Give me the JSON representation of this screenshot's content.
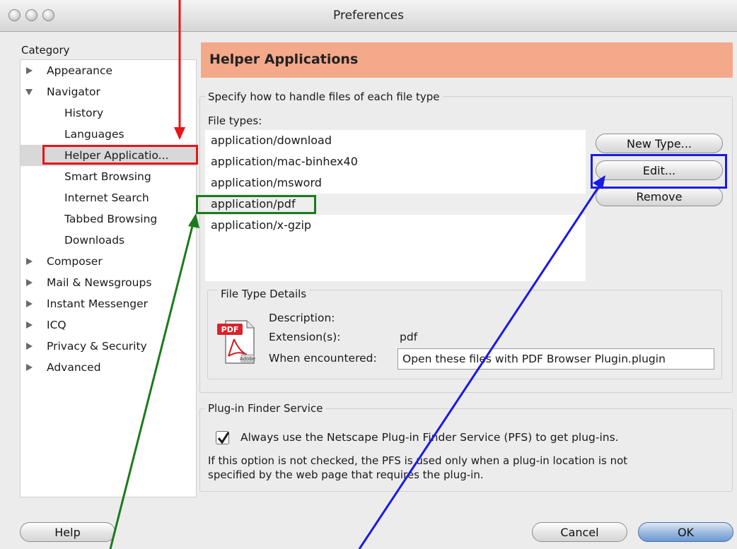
{
  "window": {
    "title": "Preferences"
  },
  "sidebar": {
    "category_label": "Category",
    "items": [
      {
        "label": "Appearance",
        "expander": "collapsed"
      },
      {
        "label": "Navigator",
        "expander": "expanded"
      },
      {
        "label": "History"
      },
      {
        "label": "Languages"
      },
      {
        "label": "Helper Applicatio..."
      },
      {
        "label": "Smart Browsing"
      },
      {
        "label": "Internet Search"
      },
      {
        "label": "Tabbed Browsing"
      },
      {
        "label": "Downloads"
      },
      {
        "label": "Composer",
        "expander": "collapsed"
      },
      {
        "label": "Mail & Newsgroups",
        "expander": "collapsed"
      },
      {
        "label": "Instant Messenger",
        "expander": "collapsed"
      },
      {
        "label": "ICQ",
        "expander": "collapsed"
      },
      {
        "label": "Privacy & Security",
        "expander": "collapsed"
      },
      {
        "label": "Advanced",
        "expander": "collapsed"
      }
    ],
    "selected_label": "Helper Applicatio..."
  },
  "main": {
    "header_title": "Helper Applications",
    "file_group": {
      "title": "Specify how to handle files of each file type",
      "file_types_label": "File types:",
      "file_types": [
        "application/download",
        "application/mac-binhex40",
        "application/msword",
        "application/pdf",
        "application/x-gzip"
      ],
      "buttons": {
        "new_type": "New Type...",
        "edit": "Edit...",
        "remove": "Remove"
      }
    },
    "details": {
      "title": "File Type Details",
      "icon": "pdf-file-icon",
      "icon_badge": "PDF",
      "icon_footer": "Adobe",
      "description_label": "Description:",
      "description_value": "",
      "extension_label": "Extension(s):",
      "extension_value": "pdf",
      "when_label": "When encountered:",
      "when_value": "Open these files with PDF Browser Plugin.plugin"
    },
    "plugin": {
      "title": "Plug-in Finder Service",
      "checkbox_label": "Always use the Netscape Plug-in Finder Service (PFS) to get plug-ins.",
      "checkbox_checked": true,
      "info_line1": "If this option is not checked, the PFS is used only when a plug-in location is not",
      "info_line2": "specified by the web page that requires the plug-in."
    }
  },
  "footer": {
    "help": "Help",
    "cancel": "Cancel",
    "ok": "OK"
  },
  "annotation_colors": {
    "red": "#e8141a",
    "green": "#1c7a1c",
    "blue": "#1a1ae6"
  }
}
